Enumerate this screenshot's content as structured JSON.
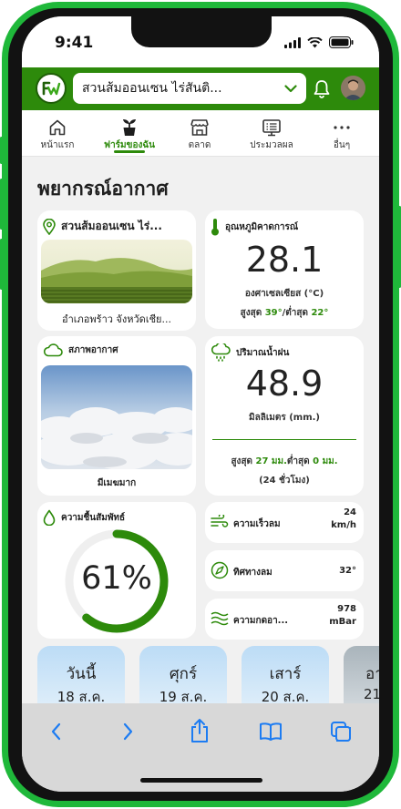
{
  "status_bar": {
    "time": "9:41"
  },
  "app_bar": {
    "farm_selector_value": "สวนส้มออนเซน ไร่สันติ...",
    "colors": {
      "brand": "#2d8a0b"
    }
  },
  "tabs": [
    {
      "label": "หน้าแรก",
      "icon": "home-icon"
    },
    {
      "label": "ฟาร์มของฉัน",
      "icon": "plant-icon",
      "active": true
    },
    {
      "label": "ตลาด",
      "icon": "store-icon"
    },
    {
      "label": "ประมวลผล",
      "icon": "report-icon"
    },
    {
      "label": "อื่นๆ",
      "icon": "more-icon"
    }
  ],
  "page": {
    "title": "พยากรณ์อากาศ"
  },
  "location_card": {
    "title": "สวนส้มออนเซน ไร่...",
    "caption": "อำเภอพร้าว จังหวัดเชีย..."
  },
  "temperature_card": {
    "title": "อุณหภูมิคาดการณ์",
    "value": "28.1",
    "unit": "องศาเซลเซียส (°C)",
    "max_label": "สูงสุด",
    "max_value": "39°",
    "min_label": "/ต่ำสุด",
    "min_value": "22°"
  },
  "condition_card": {
    "title": "สภาพอากาศ",
    "caption": "มีเมฆมาก"
  },
  "rain_card": {
    "title": "ปริมาณน้ำฝน",
    "value": "48.9",
    "unit": "มิลลิเมตร (mm.)",
    "max_label": "สูงสุด",
    "max_value": "27 มม.",
    "min_label": "ต่ำสุด",
    "min_value": "0 มม.",
    "period": "(24 ชั่วโมง)"
  },
  "humidity_card": {
    "title": "ความชื้นสัมพัทธ์",
    "value": "61%",
    "percent": 61
  },
  "wind_speed": {
    "label": "ความเร็วลม",
    "value_line1": "24",
    "value_line2": "km/h"
  },
  "wind_direction": {
    "label": "ทิศทางลม",
    "value": "32°"
  },
  "pressure": {
    "label": "ความกดอา...",
    "value_line1": "978",
    "value_line2": "mBar"
  },
  "forecast_days": [
    {
      "name": "วันนี้",
      "date": "18 ส.ค."
    },
    {
      "name": "ศุกร์",
      "date": "19 ส.ค."
    },
    {
      "name": "เสาร์",
      "date": "20 ส.ค."
    },
    {
      "name": "อา",
      "date": "21"
    }
  ]
}
